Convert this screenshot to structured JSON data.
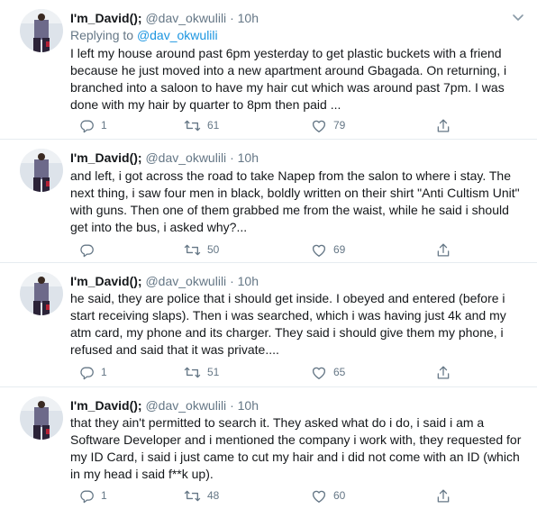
{
  "colors": {
    "text": "#14171a",
    "muted": "#657786",
    "link": "#1b95e0",
    "divider": "#e6ecf0"
  },
  "icons": {
    "reply": "reply-icon",
    "retweet": "retweet-icon",
    "like": "heart-icon",
    "share": "share-icon",
    "more": "chevron-down-icon"
  },
  "tweets": [
    {
      "name": "I'm_David();",
      "handle": "@dav_okwulili",
      "dot": "·",
      "time": "10h",
      "reply_to_label": "Replying to",
      "reply_to_handle": "@dav_okwulili",
      "text": "I left my house around past 6pm yesterday to get plastic buckets with a friend because he just moved into a new apartment around Gbagada. On returning, i branched into a saloon to have my hair cut which was around past 7pm. I was done with my hair by quarter to 8pm then paid ...",
      "replies": "1",
      "retweets": "61",
      "likes": "79"
    },
    {
      "name": "I'm_David();",
      "handle": "@dav_okwulili",
      "dot": "·",
      "time": "10h",
      "text": "and left, i got across the road to take Napep from the salon to where i stay. The next thing, i saw four men in black, boldly written on their shirt \"Anti Cultism Unit\" with guns. Then one of them grabbed me from the waist, while he said i should get into the bus, i asked why?...",
      "replies": "",
      "retweets": "50",
      "likes": "69"
    },
    {
      "name": "I'm_David();",
      "handle": "@dav_okwulili",
      "dot": "·",
      "time": "10h",
      "text": "he said, they are police that i should get inside. I obeyed and entered (before i start receiving slaps). Then i was searched, which i was having just 4k and my atm card, my phone and its charger. They said i should give them my phone, i refused and said that it was private....",
      "replies": "1",
      "retweets": "51",
      "likes": "65"
    },
    {
      "name": "I'm_David();",
      "handle": "@dav_okwulili",
      "dot": "·",
      "time": "10h",
      "text": "that they ain't permitted to search it. They asked what do i do, i said i am a Software Developer and i mentioned the company i work with, they requested for my ID Card, i said i just came to cut my hair and i did not come with an ID (which in my head i said f**k up).",
      "replies": "1",
      "retweets": "48",
      "likes": "60"
    }
  ]
}
